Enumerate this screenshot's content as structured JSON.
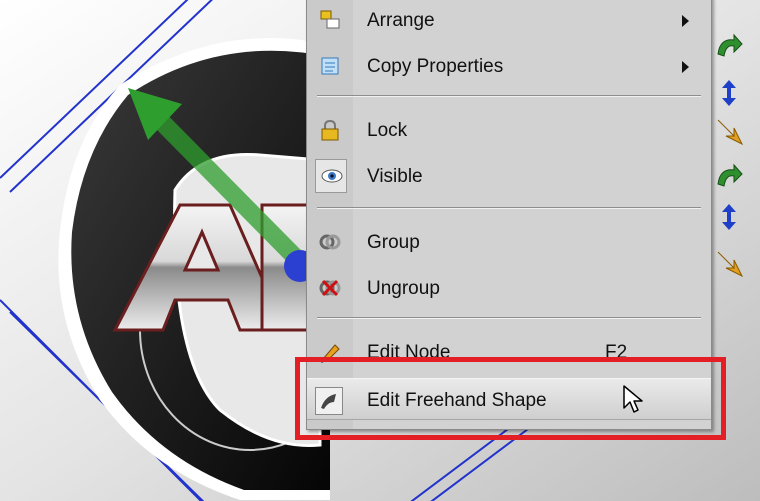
{
  "context_menu": {
    "items": [
      {
        "label": "Arrange",
        "icon": "arrange-icon",
        "submenu": true
      },
      {
        "label": "Copy Properties",
        "icon": "copy-properties-icon",
        "submenu": true
      },
      {
        "label": "Lock",
        "icon": "lock-icon"
      },
      {
        "label": "Visible",
        "icon": "eye-icon",
        "checked": true
      },
      {
        "label": "Group",
        "icon": "group-icon"
      },
      {
        "label": "Ungroup",
        "icon": "ungroup-icon"
      },
      {
        "label": "Edit Node",
        "icon": "pencil-icon",
        "shortcut": "F2"
      },
      {
        "label": "Edit Freehand Shape",
        "icon": "freehand-shape-icon",
        "hovered": true
      }
    ]
  },
  "canvas": {
    "logo_text": "AI"
  },
  "colors": {
    "highlight_box": "#e31e24",
    "menu_bg": "#d2d2d2",
    "handle_arrow": "#2e9e2e",
    "guide_lines": "#2233cc"
  }
}
